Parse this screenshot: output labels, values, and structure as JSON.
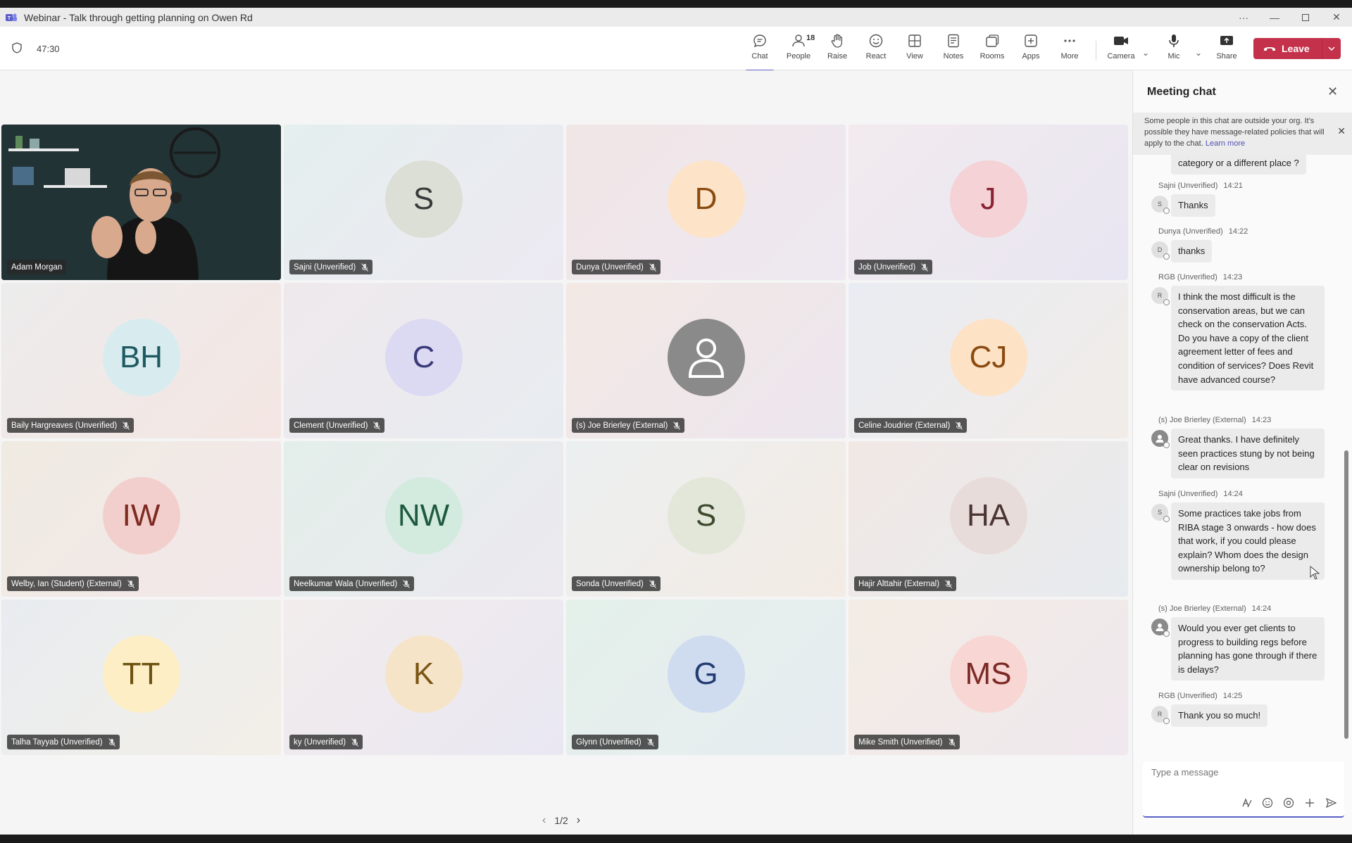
{
  "window": {
    "title": "Webinar - Talk through getting planning on Owen Rd"
  },
  "meeting": {
    "timer": "47:30"
  },
  "toolbar": {
    "chat": "Chat",
    "people": "People",
    "people_count": "18",
    "raise": "Raise",
    "react": "React",
    "view": "View",
    "notes": "Notes",
    "rooms": "Rooms",
    "apps": "Apps",
    "more": "More",
    "camera": "Camera",
    "mic": "Mic",
    "share": "Share",
    "leave": "Leave"
  },
  "colors": {
    "accent": "#5b5fc7",
    "leave": "#c4314b"
  },
  "participants": [
    {
      "name": "Adam Morgan",
      "initials": "",
      "video": true,
      "muted": false
    },
    {
      "name": "Sajni (Unverified)",
      "initials": "S",
      "bg": "#dcdfd6",
      "fg": "#3a3a3a",
      "muted": true
    },
    {
      "name": "Dunya (Unverified)",
      "initials": "D",
      "bg": "#fde4c8",
      "fg": "#8a4b10",
      "muted": true
    },
    {
      "name": "Job (Unverified)",
      "initials": "J",
      "bg": "#f4d2d6",
      "fg": "#8a2333",
      "muted": true
    },
    {
      "name": "Baily Hargreaves (Unverified)",
      "initials": "BH",
      "bg": "#d8ecef",
      "fg": "#1e5962",
      "muted": true
    },
    {
      "name": "Clement (Unverified)",
      "initials": "C",
      "bg": "#dcdaf2",
      "fg": "#3b3a7a",
      "muted": true
    },
    {
      "name": "(s) Joe Brierley (External)",
      "initials": "",
      "bg": "#8a8a8a",
      "fg": "#ffffff",
      "muted": true,
      "generic_avatar": true
    },
    {
      "name": "Celine Joudrier (External)",
      "initials": "CJ",
      "bg": "#fde2c6",
      "fg": "#8a4b10",
      "muted": true
    },
    {
      "name": "Welby, Ian (Student) (External)",
      "initials": "IW",
      "bg": "#f2cfcc",
      "fg": "#7d2a22",
      "muted": true
    },
    {
      "name": "Neelkumar Wala (Unverified)",
      "initials": "NW",
      "bg": "#d3ebdf",
      "fg": "#1f5a3e",
      "muted": true
    },
    {
      "name": "Sonda (Unverified)",
      "initials": "S",
      "bg": "#e2e7da",
      "fg": "#3d4a2e",
      "muted": true
    },
    {
      "name": "Hajir Alttahir (External)",
      "initials": "HA",
      "bg": "#e8dcdb",
      "fg": "#4a3533",
      "muted": true
    },
    {
      "name": "Talha Tayyab (Unverified)",
      "initials": "TT",
      "bg": "#fdeec6",
      "fg": "#6b5210",
      "muted": true
    },
    {
      "name": "ky (Unverified)",
      "initials": "K",
      "bg": "#f6e4c8",
      "fg": "#7a5514",
      "muted": true
    },
    {
      "name": "Glynn (Unverified)",
      "initials": "G",
      "bg": "#cfdcf0",
      "fg": "#243c73",
      "muted": true
    },
    {
      "name": "Mike Smith (Unverified)",
      "initials": "MS",
      "bg": "#f8d6d3",
      "fg": "#7b2a25",
      "muted": true
    }
  ],
  "pager": {
    "label": "1/2"
  },
  "chat": {
    "title": "Meeting chat",
    "banner": "Some people in this chat are outside your org. It's possible they have message-related policies that will apply to the chat.",
    "banner_link": "Learn more",
    "cut_message": "category or a different place ?",
    "messages": [
      {
        "sender": "Sajni (Unverified)",
        "time": "14:21",
        "initial": "S",
        "text": "Thanks"
      },
      {
        "sender": "Dunya (Unverified)",
        "time": "14:22",
        "initial": "D",
        "text": "thanks"
      },
      {
        "sender": "RGB (Unverified)",
        "time": "14:23",
        "initial": "R",
        "text": "I think the most difficult is the conservation areas, but we can check on the conservation Acts. Do you have a copy of the client agreement letter of fees and condition of services? Does Revit have advanced course?"
      },
      {
        "sender": "(s) Joe Brierley (External)",
        "time": "14:23",
        "initial": "",
        "text": "Great thanks. I have definitely seen practices stung by not being clear on revisions"
      },
      {
        "sender": "Sajni (Unverified)",
        "time": "14:24",
        "initial": "S",
        "text": "Some practices take jobs from RIBA stage 3 onwards - how does that work, if you could please explain? Whom does the design ownership belong to?"
      },
      {
        "sender": "(s) Joe Brierley (External)",
        "time": "14:24",
        "initial": "",
        "text": "Would you ever get clients to progress to building regs before planning has gone through if there is delays?"
      },
      {
        "sender": "RGB (Unverified)",
        "time": "14:25",
        "initial": "R",
        "text": "Thank you so much!"
      }
    ],
    "compose_placeholder": "Type a message"
  }
}
